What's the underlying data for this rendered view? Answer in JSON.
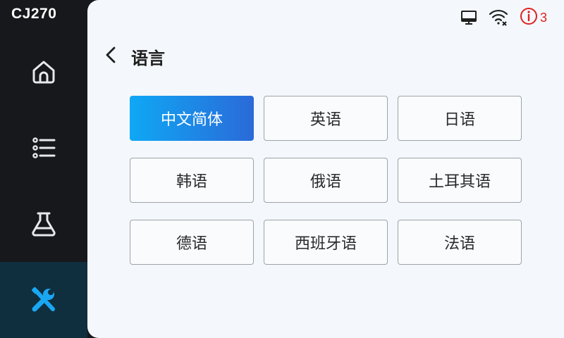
{
  "app": {
    "model": "CJ270"
  },
  "sidebar": {
    "items": [
      {
        "id": "home",
        "icon": "home-icon"
      },
      {
        "id": "list",
        "icon": "list-icon"
      },
      {
        "id": "lab",
        "icon": "flask-icon"
      },
      {
        "id": "tools",
        "icon": "tools-icon",
        "active": true
      }
    ]
  },
  "status": {
    "icons": [
      "monitor-icon",
      "wifi-disconnected-icon",
      "alert-info-icon"
    ],
    "alert_count": "3",
    "alert_color": "#e02020"
  },
  "page": {
    "title": "语言",
    "back_icon": "chevron-left-icon"
  },
  "languages": [
    {
      "label": "中文简体",
      "selected": true
    },
    {
      "label": "英语",
      "selected": false
    },
    {
      "label": "日语",
      "selected": false
    },
    {
      "label": "韩语",
      "selected": false
    },
    {
      "label": "俄语",
      "selected": false
    },
    {
      "label": "土耳其语",
      "selected": false
    },
    {
      "label": "德语",
      "selected": false
    },
    {
      "label": "西班牙语",
      "selected": false
    },
    {
      "label": "法语",
      "selected": false
    }
  ],
  "colors": {
    "accent_start": "#0fa8f5",
    "accent_end": "#2a6ad8",
    "active_nav_bg": "#0f2e3e",
    "tools_icon": "#1aa7f2"
  }
}
